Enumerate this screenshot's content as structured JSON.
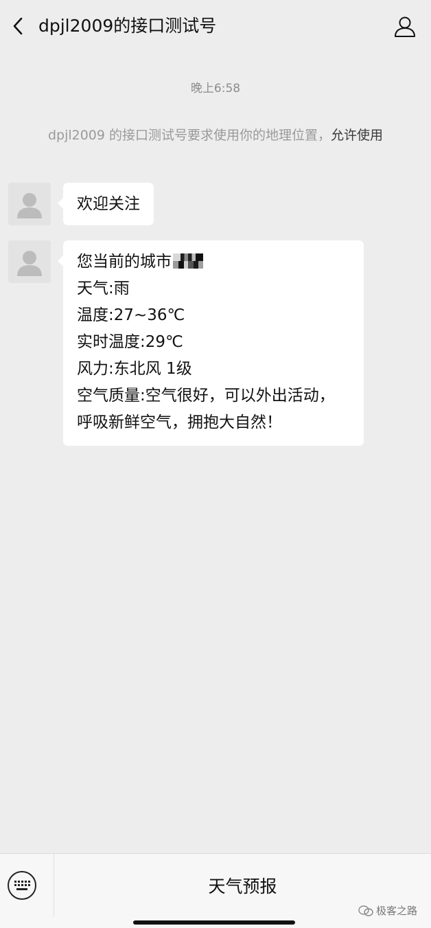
{
  "header": {
    "title": "dpjl2009的接口测试号",
    "back_icon": "chevron-left-icon",
    "profile_icon": "person-icon"
  },
  "chat": {
    "timestamp": "晚上6:58",
    "system_notice": {
      "text": "dpjl2009 的接口测试号要求使用你的地理位置，",
      "link": "允许使用"
    },
    "messages": [
      {
        "lines": [
          "欢迎关注"
        ]
      },
      {
        "lines": [
          "您当前的城市",
          "天气:雨",
          "温度:27~36℃",
          "实时温度:29℃",
          "风力:东北风 1级",
          "空气质量:空气很好，可以外出活动，呼吸新鲜空气，拥抱大自然！"
        ]
      }
    ]
  },
  "bottom_bar": {
    "keyboard_icon": "keyboard-icon",
    "menu_label": "天气预报",
    "watermark": "极客之路"
  },
  "colors": {
    "background": "#ededed",
    "bubble": "#ffffff",
    "timestamp": "#8c8c8c",
    "notice": "#9a9a9a"
  }
}
